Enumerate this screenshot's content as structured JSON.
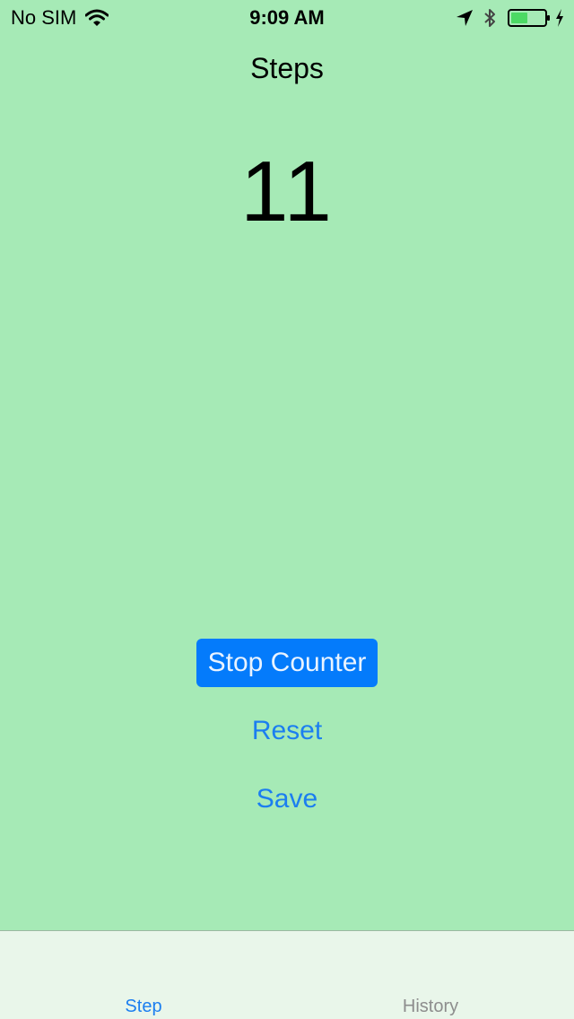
{
  "status_bar": {
    "carrier": "No SIM",
    "time": "9:09 AM",
    "icons": [
      "wifi-icon",
      "location-arrow-icon",
      "bluetooth-icon",
      "battery-icon",
      "charging-bolt-icon"
    ],
    "battery_level": 0.5
  },
  "screen": {
    "title": "Steps",
    "count": "11"
  },
  "actions": {
    "primary_label": "Stop Counter",
    "reset_label": "Reset",
    "save_label": "Save"
  },
  "tab_bar": {
    "tabs": [
      {
        "label": "Step",
        "selected": true
      },
      {
        "label": "History",
        "selected": false
      }
    ]
  },
  "colors": {
    "background": "#a6eab6",
    "accent": "#047bfb",
    "tab_bar": "#e9f6ea",
    "battery_fill": "#4cd964"
  }
}
